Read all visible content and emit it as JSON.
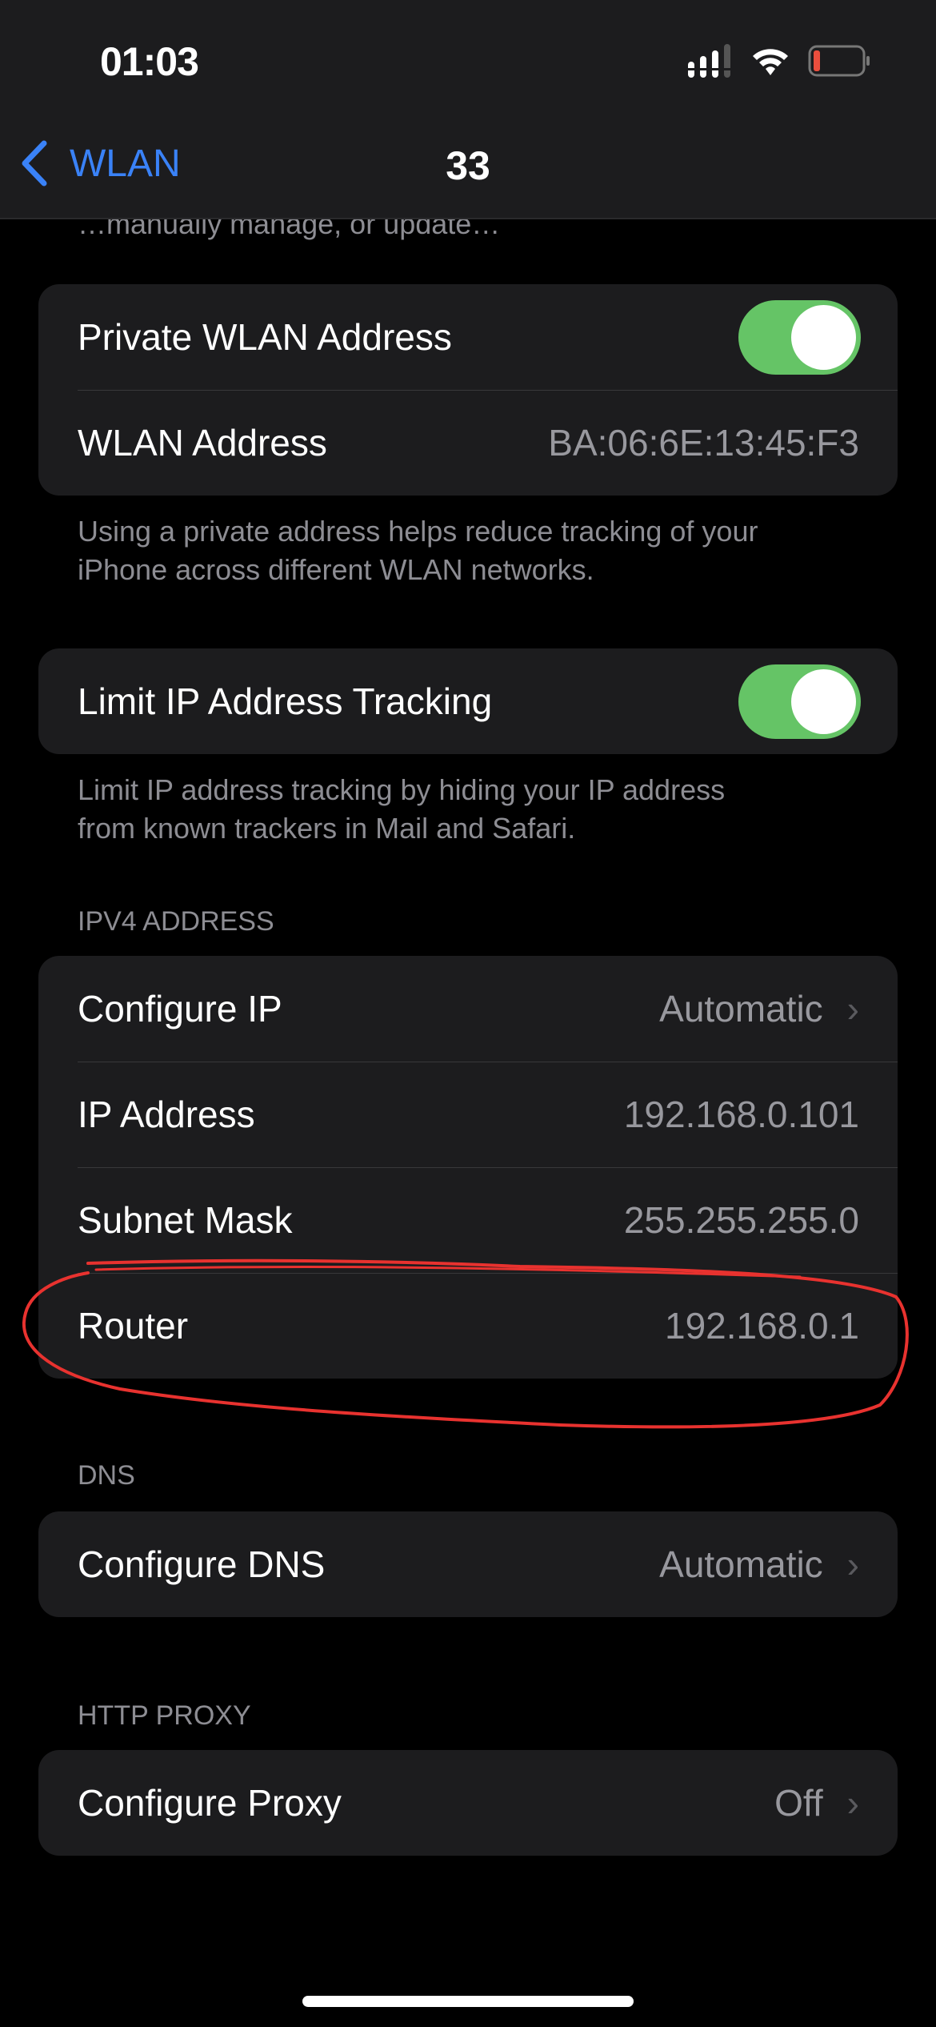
{
  "status_bar": {
    "time": "01:03",
    "signal_icon": "cellular-signal-icon",
    "wifi_icon": "wifi-icon",
    "battery_icon": "battery-low-icon",
    "battery_color": "#eb4e3d"
  },
  "nav": {
    "back_label": "WLAN",
    "title": "33",
    "accent": "#3a82f7"
  },
  "clipped_text": "…manually manage, or update…",
  "private_group": {
    "rows": [
      {
        "label": "Private WLAN Address",
        "toggle": true
      },
      {
        "label": "WLAN Address",
        "value": "BA:06:6E:13:45:F3"
      }
    ],
    "footer": [
      "Using a private address helps reduce tracking of your",
      "iPhone across different WLAN networks."
    ]
  },
  "tracking_group": {
    "rows": [
      {
        "label": "Limit IP Address Tracking",
        "toggle": true
      }
    ],
    "footer": [
      "Limit IP address tracking by hiding your IP address",
      "from known trackers in Mail and Safari."
    ]
  },
  "ipv4": {
    "header": "IPV4 ADDRESS",
    "rows": [
      {
        "label": "Configure IP",
        "value": "Automatic"
      },
      {
        "label": "IP Address",
        "value": "192.168.0.101"
      },
      {
        "label": "Subnet Mask",
        "value": "255.255.255.0"
      },
      {
        "label": "Router",
        "value": "192.168.0.1"
      }
    ]
  },
  "dns": {
    "header": "DNS",
    "rows": [
      {
        "label": "Configure DNS",
        "value": "Automatic"
      }
    ]
  },
  "proxy": {
    "header": "HTTP PROXY",
    "rows": [
      {
        "label": "Configure Proxy",
        "value": "Off"
      }
    ]
  },
  "colors": {
    "toggle_on": "#65c466",
    "annotation": "#e8322f"
  }
}
